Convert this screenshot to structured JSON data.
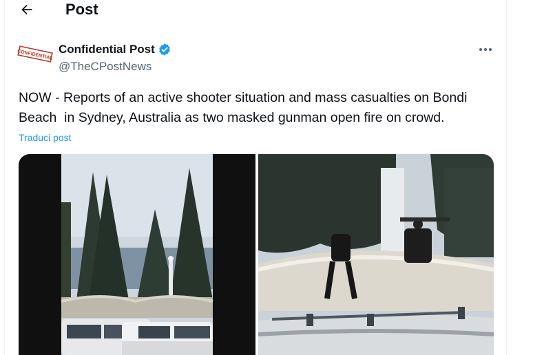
{
  "header": {
    "back_icon": "arrow-left-icon",
    "title": "Post"
  },
  "author": {
    "avatar_label": "CONFIDENTIAL",
    "display_name": "Confidential Post",
    "verified_icon": "verified-badge-icon",
    "handle": "@TheCPostNews",
    "more_icon": "more-horizontal-icon"
  },
  "tweet": {
    "text": "NOW - Reports of an active shooter situation and mass casualties on Bondi Beach  in Sydney, Australia as two masked gunman open fire on crowd.",
    "translate_label": "Traduci post"
  },
  "colors": {
    "accent": "#1d9bf0",
    "secondary_text": "#536471",
    "primary_text": "#0f1419"
  }
}
